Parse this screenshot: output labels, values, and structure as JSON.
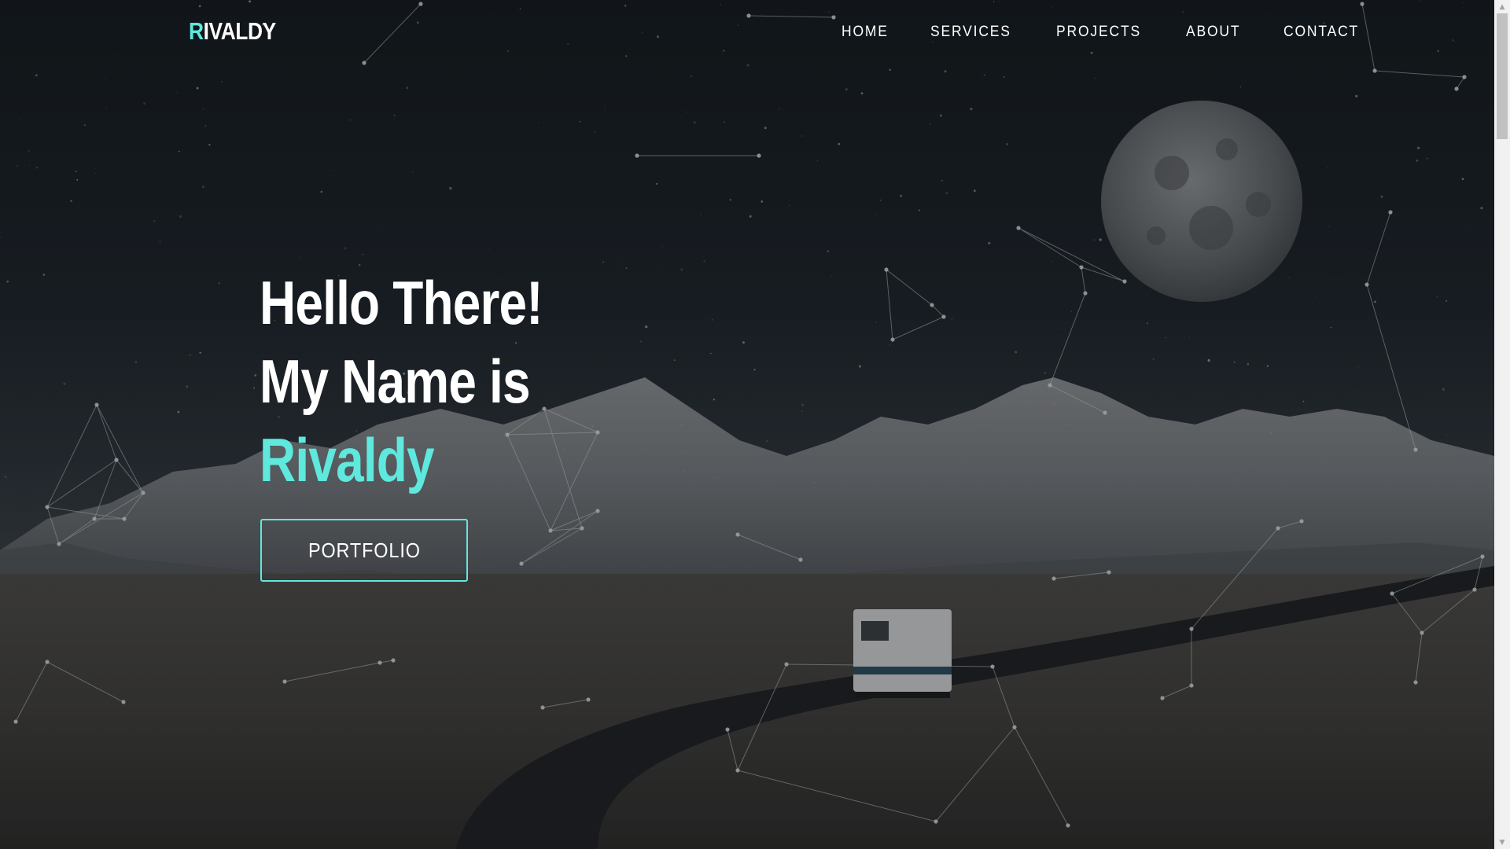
{
  "brand": {
    "first_letter": "R",
    "rest": "IVALDY"
  },
  "nav": {
    "items": [
      "HOME",
      "SERVICES",
      "PROJECTS",
      "ABOUT",
      "CONTACT"
    ]
  },
  "hero": {
    "line1": "Hello There!",
    "line2": "My Name is",
    "name": "Rivaldy",
    "button_label": "PORTFOLIO"
  },
  "colors": {
    "accent": "#5fe8dd",
    "text": "#ffffff",
    "background": "#1a1f24"
  },
  "scrollbar": {
    "up_icon": "triangle-up-icon",
    "down_icon": "triangle-down-icon"
  }
}
